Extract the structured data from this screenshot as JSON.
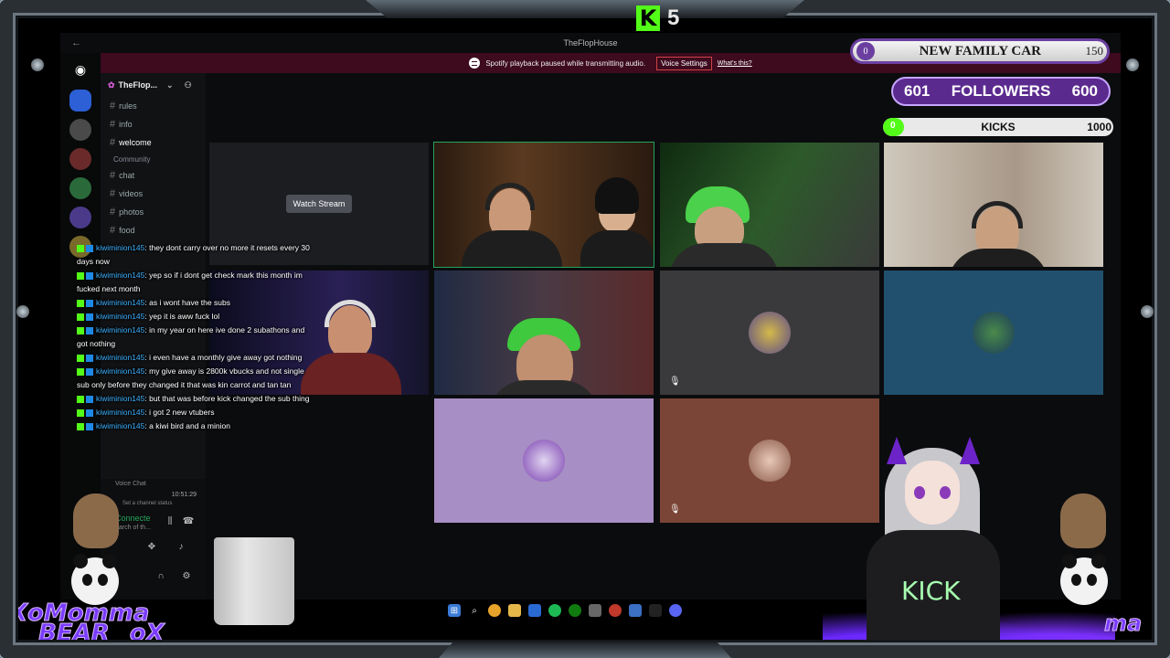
{
  "overlay": {
    "kick_counter": "5",
    "goal": {
      "left": "0",
      "title": "NEW FAMILY CAR",
      "right": "150"
    },
    "followers": {
      "left": "601",
      "label": "FOLLOWERS",
      "right": "600"
    },
    "kicks": {
      "left": "0",
      "label": "KICKS",
      "right": "1000",
      "progress": 0
    },
    "brand_left": [
      "Momma",
      "BEAR"
    ],
    "brand_prefix": "Xo",
    "brand_suffix": "oX",
    "brand_right": "ma",
    "vtuber_shirt": "KICK",
    "colors": {
      "kick_green": "#53fc18",
      "purple": "#5b2a8f",
      "notice_bg": "#3d0a1e"
    }
  },
  "discord": {
    "window_title": "TheFlopHouse",
    "notice": {
      "text": "Spotify playback paused while transmitting audio.",
      "button": "Voice Settings",
      "link": "What's this?"
    },
    "server_name": "TheFlop...",
    "channels": [
      {
        "label": "rules"
      },
      {
        "label": "info"
      },
      {
        "label": "welcome",
        "active": true
      }
    ],
    "category": "Community",
    "community_channels": [
      {
        "label": "chat"
      },
      {
        "label": "videos"
      },
      {
        "label": "photos"
      },
      {
        "label": "food"
      }
    ],
    "panel": {
      "voice_connected": "Connecte",
      "voice_sub": "earch of th...",
      "set_status": "Set a channel status",
      "time": "10:51:29",
      "voice_chat": "Voice Chat"
    },
    "watch_stream": "Watch Stream"
  },
  "chat": [
    {
      "user": "kiwiminion145",
      "message": ": they dont carry over no more it resets every 30 days now"
    },
    {
      "user": "kiwiminion145",
      "message": ": yep so if i dont get check mark this month im fucked next month"
    },
    {
      "user": "kiwiminion145",
      "message": ": as i wont have the subs"
    },
    {
      "user": "kiwiminion145",
      "message": ": yep it is aww fuck lol"
    },
    {
      "user": "kiwiminion145",
      "message": ": in my year on here ive done 2 subathons and got nothing"
    },
    {
      "user": "kiwiminion145",
      "message": ": i even have a monthly give away got nothing"
    },
    {
      "user": "kiwiminion145",
      "message": ": my give away is 2800k vbucks and not single sub only before they changed it that was kin carrot and tan tan"
    },
    {
      "user": "kiwiminion145",
      "message": ": but that was before kick changed the sub thing"
    },
    {
      "user": "kiwiminion145",
      "message": ": i got 2 new vtubers"
    },
    {
      "user": "kiwiminion145",
      "message": ": a kiwi bird and a minion"
    }
  ]
}
